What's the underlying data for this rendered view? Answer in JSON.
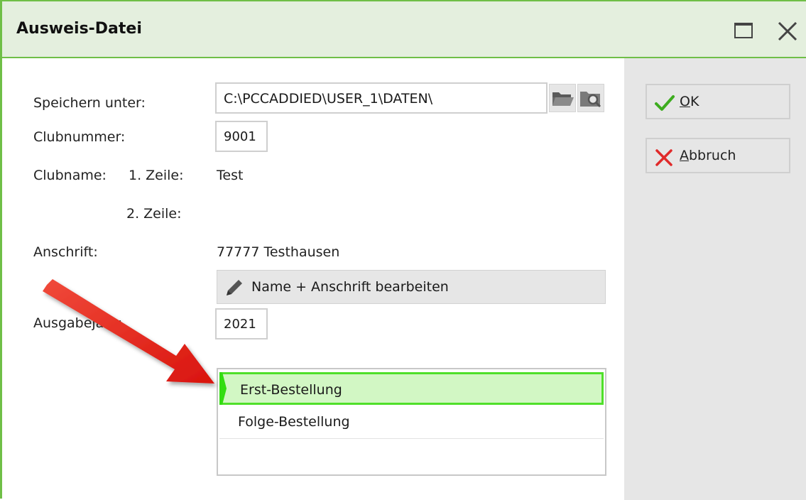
{
  "window": {
    "title": "Ausweis-Datei"
  },
  "form": {
    "save_label": "Speichern unter:",
    "save_path": "C:\\PCCADDIED\\USER_1\\DATEN\\",
    "club_number_label": "Clubnummer:",
    "club_number": "9001",
    "club_name_label": "Clubname:",
    "line1_label": "1. Zeile:",
    "line1_value": "Test",
    "line2_label": "2. Zeile:",
    "address_label": "Anschrift:",
    "address_value": "77777 Testhausen",
    "edit_button": "Name + Anschrift bearbeiten",
    "year_label": "Ausgabejahr:",
    "year_value": "2021"
  },
  "order_list": {
    "items": [
      "Erst-Bestellung",
      "Folge-Bestellung"
    ],
    "selected_index": 0
  },
  "actions": {
    "ok_mnemonic": "O",
    "ok_rest": "K",
    "cancel_mnemonic": "A",
    "cancel_rest": "bbruch"
  },
  "colors": {
    "accent_green": "#6fbf47",
    "selection_border": "#4fe02a",
    "selection_fill": "#d2f7c4",
    "annotation_arrow": "#e8201a"
  }
}
